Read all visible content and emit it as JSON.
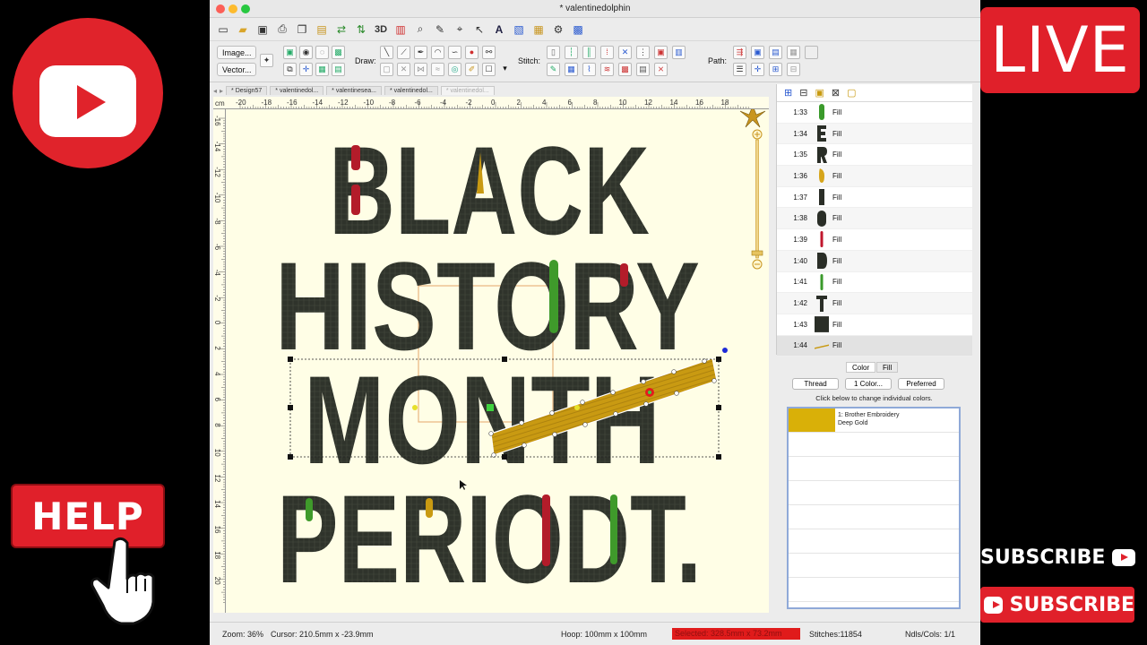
{
  "overlays": {
    "live_label": "LIVE",
    "help_label": "HELP",
    "subscribe_label": "SUBSCRIBE",
    "colors": {
      "youtube_red": "#e0232b"
    }
  },
  "window": {
    "title": "* valentinedolphin"
  },
  "toolbar": {
    "image_label": "Image...",
    "vector_label": "Vector...",
    "draw_label": "Draw:",
    "stitch_label": "Stitch:",
    "path_label": "Path:",
    "three_d_label": "3D"
  },
  "tabs": [
    {
      "label": "* Design57"
    },
    {
      "label": "* valentinedol..."
    },
    {
      "label": "* valentinesea..."
    },
    {
      "label": "* valentinedol..."
    },
    {
      "label": "* valentinedol..."
    }
  ],
  "ruler": {
    "unit": "cm",
    "top_ticks": [
      "-20",
      "-18",
      "-16",
      "-14",
      "-12",
      "-10",
      "-8",
      "-6",
      "-4",
      "-2",
      "0",
      "2",
      "4",
      "6",
      "8",
      "10",
      "12",
      "14",
      "16",
      "18"
    ],
    "left_ticks": [
      "-16",
      "-14",
      "-12",
      "-10",
      "-8",
      "-6",
      "-4",
      "-2",
      "0",
      "2",
      "4",
      "6",
      "8",
      "10",
      "12",
      "14",
      "16",
      "18",
      "20"
    ]
  },
  "design": {
    "lines": [
      "BLACK",
      "HISTORY",
      "MONTH",
      "PERIODT."
    ],
    "colors": {
      "fill": "#2f332b",
      "gold": "#c99a12",
      "red": "#b31c2a",
      "green": "#3f9a2b",
      "canvas": "#fffee6"
    }
  },
  "stitch_list": {
    "rows": [
      {
        "num": "1:33",
        "type": "Fill",
        "color": "#3a9a2b",
        "shape": "bar"
      },
      {
        "num": "1:34",
        "type": "Fill",
        "color": "#2a2e27",
        "shape": "E"
      },
      {
        "num": "1:35",
        "type": "Fill",
        "color": "#2a2e27",
        "shape": "R"
      },
      {
        "num": "1:36",
        "type": "Fill",
        "color": "#d6a51b",
        "shape": "drop"
      },
      {
        "num": "1:37",
        "type": "Fill",
        "color": "#2a2e27",
        "shape": "I"
      },
      {
        "num": "1:38",
        "type": "Fill",
        "color": "#2a2e27",
        "shape": "O"
      },
      {
        "num": "1:39",
        "type": "Fill",
        "color": "#c0172d",
        "shape": "thin"
      },
      {
        "num": "1:40",
        "type": "Fill",
        "color": "#2a2e27",
        "shape": "D"
      },
      {
        "num": "1:41",
        "type": "Fill",
        "color": "#3a9a2b",
        "shape": "thin"
      },
      {
        "num": "1:42",
        "type": "Fill",
        "color": "#2a2e27",
        "shape": "T"
      },
      {
        "num": "1:43",
        "type": "Fill",
        "color": "#2a2e27",
        "shape": "block"
      },
      {
        "num": "1:44",
        "type": "Fill",
        "color": "#c99a12",
        "shape": "slash"
      }
    ]
  },
  "color_panel": {
    "tab_color": "Color",
    "tab_fill": "Fill",
    "thread_button": "Thread",
    "one_color_button": "1 Color...",
    "preferred_button": "Preferred",
    "hint": "Click below to change individual colors.",
    "threads": [
      {
        "line1": "1: Brother Embroidery",
        "line2": "Deep Gold",
        "color": "#d9b008"
      }
    ]
  },
  "status": {
    "zoom": "Zoom: 36%",
    "cursor": "Cursor: 210.5mm x -23.9mm",
    "hoop": "Hoop: 100mm x 100mm",
    "selected": "Selected: 328.5mm x 73.2mm",
    "stitches": "Stitches:11854",
    "ndls": "Ndls/Cols: 1/1"
  }
}
